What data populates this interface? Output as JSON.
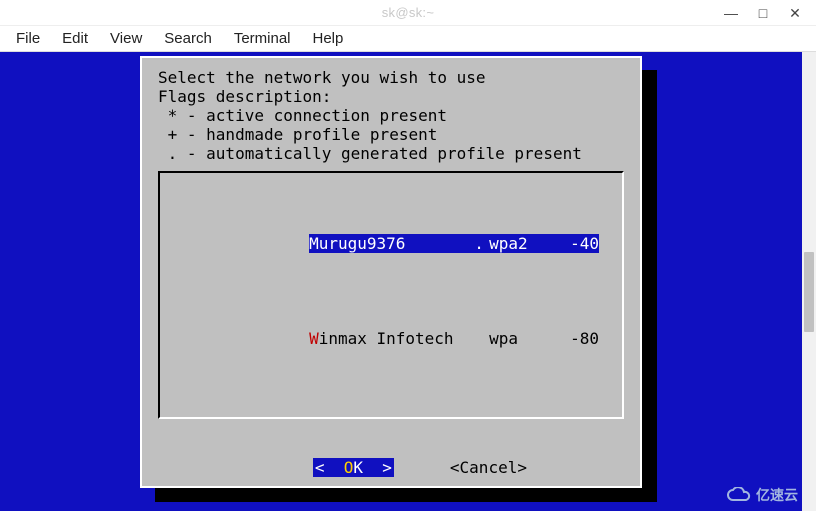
{
  "window": {
    "title": "sk@sk:~",
    "controls": {
      "min": "—",
      "max": "□",
      "close": "✕"
    }
  },
  "menubar": {
    "items": [
      "File",
      "Edit",
      "View",
      "Search",
      "Terminal",
      "Help"
    ]
  },
  "dialog": {
    "instructions": "Select the network you wish to use\nFlags description:\n * - active connection present\n + - handmade profile present\n . - automatically generated profile present",
    "networks": [
      {
        "name": "Murugu9376",
        "hotkey": "M",
        "rest": "urugu9376",
        "flag": ".",
        "enc": "wpa2",
        "signal": "-40",
        "selected": true
      },
      {
        "name": "Winmax Infotech",
        "hotkey": "W",
        "rest": "inmax Infotech",
        "flag": "",
        "enc": "wpa",
        "signal": "-80",
        "selected": false
      }
    ],
    "buttons": {
      "ok": {
        "pre": "<  ",
        "hot": "O",
        "rest": "K  >"
      },
      "cancel": "<Cancel>"
    }
  },
  "watermark": "亿速云"
}
